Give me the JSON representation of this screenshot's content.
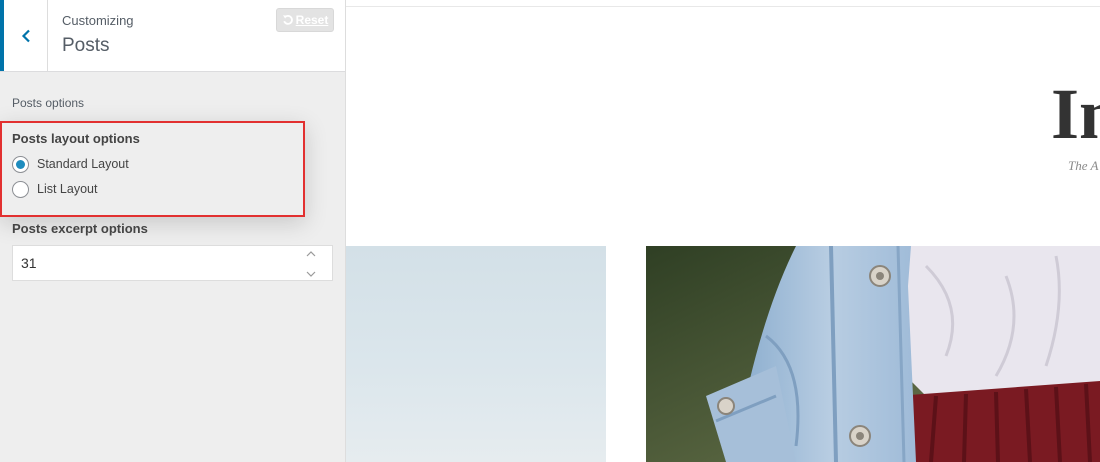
{
  "header": {
    "customizing_label": "Customizing",
    "section_title": "Posts",
    "reset_label": "Reset"
  },
  "panel": {
    "section_label": "Posts options",
    "layout": {
      "title": "Posts layout options",
      "options": [
        {
          "label": "Standard Layout",
          "checked": true
        },
        {
          "label": "List Layout",
          "checked": false
        }
      ]
    },
    "excerpt": {
      "title": "Posts excerpt options",
      "value": "31"
    }
  },
  "preview": {
    "site_title": "In",
    "tagline": "The A"
  },
  "colors": {
    "accent": "#0073aa",
    "radio_checked": "#1e8cbe",
    "highlight_border": "#e23030",
    "panel_bg": "#eeeeee",
    "denim": "#a9c3dd",
    "skirt": "#7a1a22"
  }
}
